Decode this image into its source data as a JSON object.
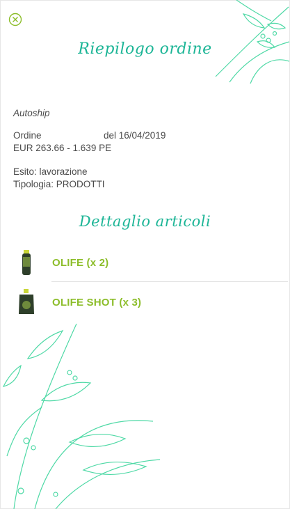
{
  "header": {
    "title": "Riepilogo ordine",
    "close_icon": "close-circle-icon"
  },
  "order": {
    "type": "Autoship",
    "order_label": "Ordine",
    "order_date": "del 16/04/2019",
    "amounts": "EUR 263.66 - 1.639 PE",
    "status": "Esito: lavorazione",
    "typology": "Tipologia: PRODOTTI"
  },
  "details": {
    "title": "Dettaglio articoli",
    "items": [
      {
        "name": "OLIFE (x 2)",
        "icon": "bottle-icon"
      },
      {
        "name": "OLIFE SHOT (x 3)",
        "icon": "pouch-icon"
      }
    ]
  },
  "colors": {
    "accent": "#1cb596",
    "product": "#8cbd2a",
    "leaf": "#4fd9a6"
  }
}
